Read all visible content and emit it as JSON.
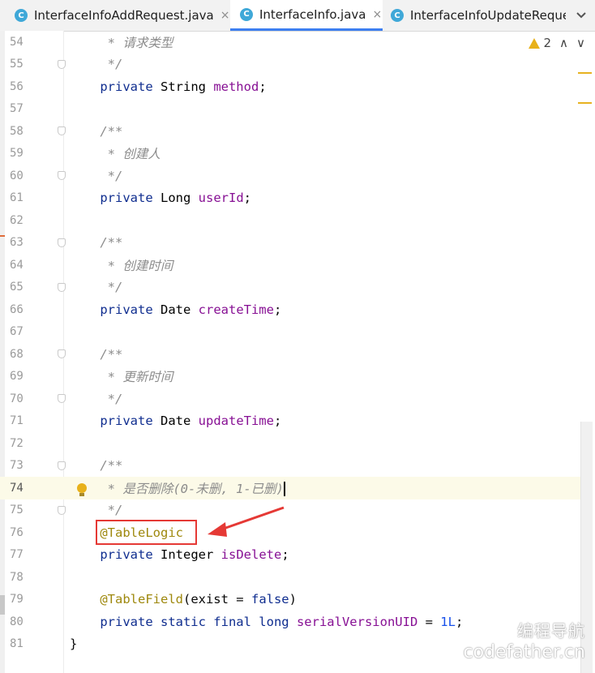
{
  "tabs": [
    {
      "label": "InterfaceInfoAddRequest.java",
      "icon": "class-icon",
      "icon_glyph": "C",
      "close": "×",
      "active": false
    },
    {
      "label": "InterfaceInfo.java",
      "icon": "class-icon",
      "icon_glyph": "C",
      "close": "×",
      "active": true
    },
    {
      "label": "InterfaceInfoUpdateRequest.java",
      "icon": "class-icon",
      "icon_glyph": "C",
      "active": false
    }
  ],
  "tab_overflow_icon": "chevron-down-icon",
  "inspection": {
    "warning_count": "2",
    "up": "∧",
    "down": "∨"
  },
  "editor": {
    "current_line": 74,
    "lines": [
      {
        "n": "54",
        "tokens": [
          {
            "t": "     * 请求类型",
            "c": "cm"
          }
        ],
        "fold": false
      },
      {
        "n": "55",
        "tokens": [
          {
            "t": "     */",
            "c": "cm"
          }
        ],
        "fold": true
      },
      {
        "n": "56",
        "tokens": [
          {
            "t": "    ",
            "c": "plain"
          },
          {
            "t": "private",
            "c": "kw"
          },
          {
            "t": " String ",
            "c": "ty"
          },
          {
            "t": "method",
            "c": "fld"
          },
          {
            "t": ";",
            "c": "plain"
          }
        ]
      },
      {
        "n": "57",
        "tokens": []
      },
      {
        "n": "58",
        "tokens": [
          {
            "t": "    /**",
            "c": "cm"
          }
        ],
        "fold": true
      },
      {
        "n": "59",
        "tokens": [
          {
            "t": "     * 创建人",
            "c": "cm"
          }
        ]
      },
      {
        "n": "60",
        "tokens": [
          {
            "t": "     */",
            "c": "cm"
          }
        ],
        "fold": true
      },
      {
        "n": "61",
        "tokens": [
          {
            "t": "    ",
            "c": "plain"
          },
          {
            "t": "private",
            "c": "kw"
          },
          {
            "t": " Long ",
            "c": "ty"
          },
          {
            "t": "userId",
            "c": "fld"
          },
          {
            "t": ";",
            "c": "plain"
          }
        ]
      },
      {
        "n": "62",
        "tokens": []
      },
      {
        "n": "63",
        "tokens": [
          {
            "t": "    /**",
            "c": "cm"
          }
        ],
        "fold": true
      },
      {
        "n": "64",
        "tokens": [
          {
            "t": "     * 创建时间",
            "c": "cm"
          }
        ]
      },
      {
        "n": "65",
        "tokens": [
          {
            "t": "     */",
            "c": "cm"
          }
        ],
        "fold": true
      },
      {
        "n": "66",
        "tokens": [
          {
            "t": "    ",
            "c": "plain"
          },
          {
            "t": "private",
            "c": "kw"
          },
          {
            "t": " Date ",
            "c": "ty"
          },
          {
            "t": "createTime",
            "c": "fld"
          },
          {
            "t": ";",
            "c": "plain"
          }
        ]
      },
      {
        "n": "67",
        "tokens": []
      },
      {
        "n": "68",
        "tokens": [
          {
            "t": "    /**",
            "c": "cm"
          }
        ],
        "fold": true
      },
      {
        "n": "69",
        "tokens": [
          {
            "t": "     * 更新时间",
            "c": "cm"
          }
        ]
      },
      {
        "n": "70",
        "tokens": [
          {
            "t": "     */",
            "c": "cm"
          }
        ],
        "fold": true
      },
      {
        "n": "71",
        "tokens": [
          {
            "t": "    ",
            "c": "plain"
          },
          {
            "t": "private",
            "c": "kw"
          },
          {
            "t": " Date ",
            "c": "ty"
          },
          {
            "t": "updateTime",
            "c": "fld"
          },
          {
            "t": ";",
            "c": "plain"
          }
        ]
      },
      {
        "n": "72",
        "tokens": []
      },
      {
        "n": "73",
        "tokens": [
          {
            "t": "    /**",
            "c": "cm"
          }
        ],
        "fold": true
      },
      {
        "n": "74",
        "tokens": [
          {
            "t": "     * 是否删除(0-未删, 1-已删)",
            "c": "cm"
          }
        ],
        "caret": true,
        "bulb": true
      },
      {
        "n": "75",
        "tokens": [
          {
            "t": "     */",
            "c": "cm"
          }
        ],
        "fold": true
      },
      {
        "n": "76",
        "tokens": [
          {
            "t": "    ",
            "c": "plain"
          },
          {
            "t": "@TableLogic",
            "c": "ann"
          }
        ]
      },
      {
        "n": "77",
        "tokens": [
          {
            "t": "    ",
            "c": "plain"
          },
          {
            "t": "private",
            "c": "kw"
          },
          {
            "t": " Integer ",
            "c": "ty"
          },
          {
            "t": "isDelete",
            "c": "fld"
          },
          {
            "t": ";",
            "c": "plain"
          }
        ]
      },
      {
        "n": "78",
        "tokens": []
      },
      {
        "n": "79",
        "tokens": [
          {
            "t": "    ",
            "c": "plain"
          },
          {
            "t": "@TableField",
            "c": "ann"
          },
          {
            "t": "(exist = ",
            "c": "plain"
          },
          {
            "t": "false",
            "c": "kw"
          },
          {
            "t": ")",
            "c": "plain"
          }
        ]
      },
      {
        "n": "80",
        "tokens": [
          {
            "t": "    ",
            "c": "plain"
          },
          {
            "t": "private static final long ",
            "c": "kw"
          },
          {
            "t": "serialVersionUID",
            "c": "fld"
          },
          {
            "t": " = ",
            "c": "plain"
          },
          {
            "t": "1L",
            "c": "num"
          },
          {
            "t": ";",
            "c": "plain"
          }
        ]
      },
      {
        "n": "81",
        "tokens": [
          {
            "t": "}",
            "c": "plain"
          }
        ]
      }
    ]
  },
  "annotation_highlight": {
    "color": "#e53935",
    "target": "@TableLogic"
  },
  "watermark": {
    "line1": "编程导航",
    "line2": "codefather.cn"
  },
  "colors": {
    "keyword": "#0f2d8f",
    "field": "#871094",
    "comment": "#8c8c8c",
    "annotation": "#9e880d",
    "number": "#1750eb",
    "accent": "#3e7ff0",
    "current_line_bg": "#fcfae8"
  }
}
